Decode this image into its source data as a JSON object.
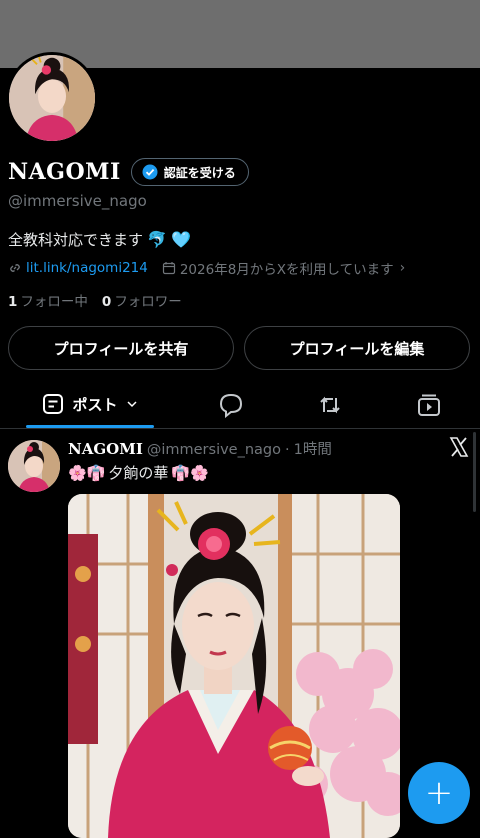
{
  "profile": {
    "display_name": "NAGOMI",
    "verify_label": "認証を受ける",
    "handle": "@immersive_nago",
    "bio_text": "全教科対応できます",
    "bio_emojis": [
      "🐬",
      "🩵"
    ],
    "link": "lit.link/nagomi214",
    "joined": "2026年8月からXを利用しています",
    "following_count": "1",
    "following_label": "フォロー中",
    "followers_count": "0",
    "followers_label": "フォロワー"
  },
  "actions": {
    "share_label": "プロフィールを共有",
    "edit_label": "プロフィールを編集"
  },
  "tabs": {
    "posts_label": "ポスト",
    "icons": [
      "reply-icon",
      "repost-icon",
      "media-icon"
    ]
  },
  "post": {
    "author": "NAGOMI",
    "handle": "@immersive_nago",
    "separator": "·",
    "time": "1時間",
    "text_prefix": "🌸👘",
    "text": "夕餉の華",
    "text_suffix": "👘🌸"
  },
  "colors": {
    "accent": "#1d9bf0",
    "banner": "#6e6e6e",
    "background": "#000000",
    "muted": "#71767b"
  },
  "fab": {
    "icon": "plus-icon",
    "label": "+"
  }
}
